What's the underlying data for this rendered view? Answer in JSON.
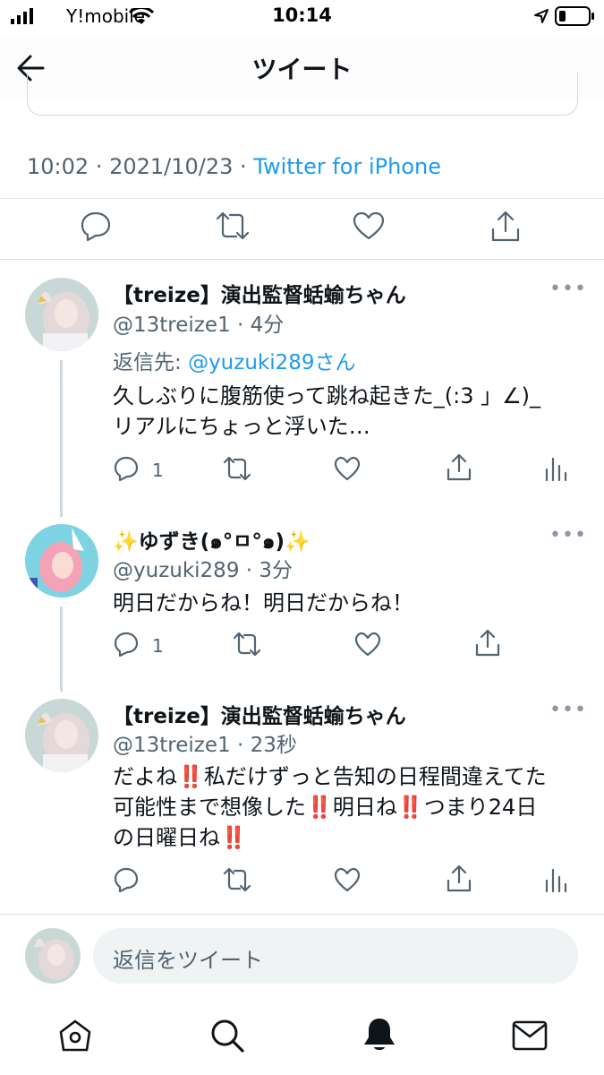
{
  "status_bar": {
    "carrier": "Y!mobile",
    "time": "10:14"
  },
  "header": {
    "title": "ツイート"
  },
  "main_tweet": {
    "time": "10:02",
    "date": "2021/10/23",
    "source": "Twitter for iPhone"
  },
  "replies": [
    {
      "name": "【treize】演出監督蛞蝓ちゃん",
      "handle": "@13treize1",
      "time": "4分",
      "reply_to_prefix": "返信先: ",
      "reply_to_handle": "@yuzuki289さん",
      "text_line1": "久しぶりに腹筋使って跳ね起きた_(:3 」∠)_",
      "text_line2": "リアルにちょっと浮いた…",
      "reply_count": "1"
    },
    {
      "name": "✨ゆずき(๑°ㅁ°๑)✨",
      "handle": "@yuzuki289",
      "time": "3分",
      "text_line1": "明日だからね！明日だからね！",
      "reply_count": "1"
    },
    {
      "name": "【treize】演出監督蛞蝓ちゃん",
      "handle": "@13treize1",
      "time": "23秒",
      "text_a": "だよね",
      "text_b": "私だけずっと告知の日程間違えてた",
      "text_c": "可能性まで想像した",
      "text_d": "明日ね",
      "text_e": "つまり24日",
      "text_f": "の日曜日ね",
      "bang": "‼️"
    }
  ],
  "reply_bar": {
    "placeholder": "返信をツイート"
  },
  "tab_bar": {
    "icons": [
      "home-icon",
      "search-icon",
      "notifications-icon",
      "messages-icon"
    ]
  },
  "colors": {
    "accent": "#1d9bf0",
    "secondary_text": "#536471",
    "divider": "#dfe3e6"
  }
}
